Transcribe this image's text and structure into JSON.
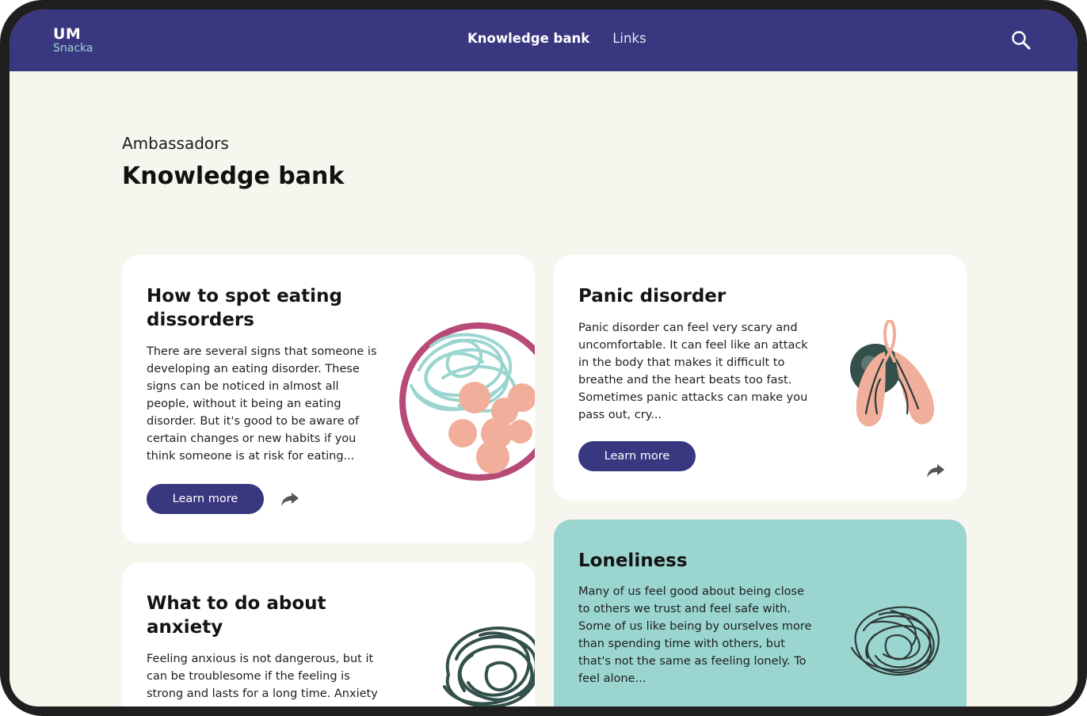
{
  "navbar": {
    "logo_top": "UM",
    "logo_bottom": "Snacka",
    "links": [
      {
        "label": "Knowledge bank",
        "active": true
      },
      {
        "label": "Links",
        "active": false
      }
    ],
    "search_icon": "search-icon"
  },
  "header": {
    "eyebrow": "Ambassadors",
    "title": "Knowledge bank"
  },
  "cards": [
    {
      "title": "How to spot eating dissorders",
      "body": "There are several signs that someone is developing an eating disorder. These signs can be noticed in almost all people, without it being an eating disorder. But it's good to be aware of certain changes or new habits if you think someone is at risk for eating...",
      "button": "Learn more",
      "icon": "share-icon",
      "illustration": "plate-illustration"
    },
    {
      "title": "Panic disorder",
      "body": "Panic disorder can feel very scary and uncomfortable. It can feel like an attack in the body that makes it difficult to breathe and the heart beats too fast. Sometimes panic attacks can make you pass out, cry...",
      "button": "Learn more",
      "icon": "share-icon",
      "illustration": "lungs-illustration"
    },
    {
      "title": "What to do about anxiety",
      "body": "Feeling anxious is not dangerous, but it can be troublesome if the feeling is strong and lasts for a long time. Anxiety",
      "illustration": "scribble-illustration"
    },
    {
      "title": "Loneliness",
      "body": "Many of us feel good about being close to others we trust and feel safe with. Some of us like being by ourselves more than spending time with others, but that's not the same as feeling lonely. To feel alone...",
      "illustration": "scribble-illustration"
    }
  ],
  "colors": {
    "primary": "#3a3781",
    "teal": "#9bd5cf",
    "background": "#f6f5ee",
    "salmon": "#f0ae9b",
    "magenta": "#b84a78",
    "dark_green": "#33504b"
  }
}
